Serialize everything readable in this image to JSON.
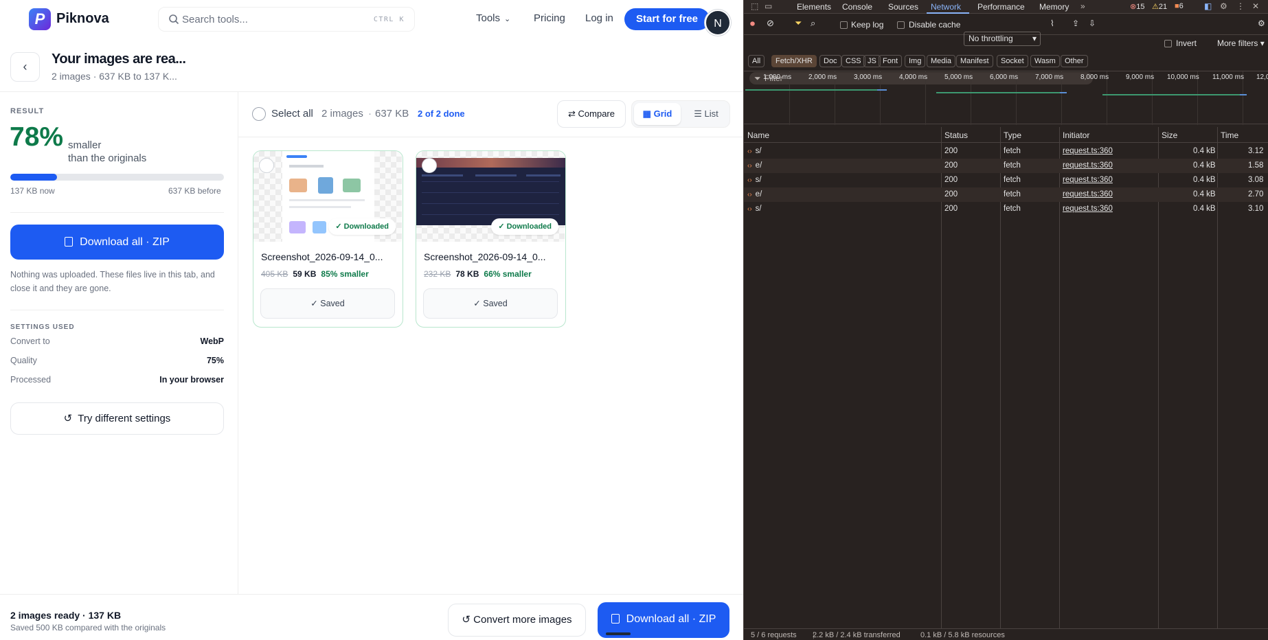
{
  "nav": {
    "logo_letter": "P",
    "logo_name": "Piknova",
    "search_placeholder": "Search tools...",
    "search_shortcut": "CTRL K",
    "tools": "Tools",
    "pricing": "Pricing",
    "login": "Log in",
    "start": "Start for free",
    "avatar_initial": "N"
  },
  "header": {
    "title": "Your images are rea...",
    "subtitle": "2 images · 637 KB to 137 K..."
  },
  "sidebar": {
    "result_label": "RESULT",
    "percent": "78%",
    "smaller": "smaller",
    "than": "than the originals",
    "progress_fraction": 0.22,
    "now": "137 KB now",
    "before": "637 KB before",
    "download_zip": "Download all · ZIP",
    "note": "Nothing was uploaded. These files live in this tab, and close it and they are gone.",
    "settings_label": "SETTINGS USED",
    "settings": [
      {
        "label": "Convert to",
        "value": "WebP"
      },
      {
        "label": "Quality",
        "value": "75%"
      },
      {
        "label": "Processed",
        "value": "In your browser"
      }
    ],
    "try_different": "Try different settings"
  },
  "toolbar": {
    "select_all": "Select all",
    "count": "2 images",
    "dot": "·",
    "size": "637 KB",
    "done": "2 of 2 done",
    "compare": "Compare",
    "grid": "Grid",
    "list": "List"
  },
  "cards": [
    {
      "name": "Screenshot_2026-09-14_0...",
      "old": "405 KB",
      "new": "59 KB",
      "pct": "85% smaller",
      "badge": "Downloaded",
      "saved": "Saved"
    },
    {
      "name": "Screenshot_2026-09-14_0...",
      "old": "232 KB",
      "new": "78 KB",
      "pct": "66% smaller",
      "badge": "Downloaded",
      "saved": "Saved"
    }
  ],
  "bottom": {
    "title": "2 images ready · 137 KB",
    "sub": "Saved 500 KB compared with the originals",
    "convert_more": "Convert more images",
    "download_zip": "Download all · ZIP"
  },
  "devtools": {
    "tabs": [
      "Elements",
      "Console",
      "Sources",
      "Network",
      "Performance",
      "Memory"
    ],
    "active_tab": "Network",
    "errors": "15",
    "warnings": "21",
    "issues": "6",
    "keep_log": "Keep log",
    "disable_cache": "Disable cache",
    "throttling": "No throttling",
    "filter_placeholder": "Filter",
    "invert": "Invert",
    "more_filters": "More filters",
    "chips": [
      "All",
      "Fetch/XHR",
      "Doc",
      "CSS",
      "JS",
      "Font",
      "Img",
      "Media",
      "Manifest",
      "Socket",
      "Wasm",
      "Other"
    ],
    "active_chip": "Fetch/XHR",
    "timeline_labels": [
      "1,000 ms",
      "2,000 ms",
      "3,000 ms",
      "4,000 ms",
      "5,000 ms",
      "6,000 ms",
      "7,000 ms",
      "8,000 ms",
      "9,000 ms",
      "10,000 ms",
      "11,000 ms",
      "12,0"
    ],
    "columns": [
      "Name",
      "Status",
      "Type",
      "Initiator",
      "Size",
      "Time"
    ],
    "rows": [
      {
        "name": "s/",
        "status": "200",
        "type": "fetch",
        "initiator": "request.ts:360",
        "size": "0.4 kB",
        "time": "3.12"
      },
      {
        "name": "e/",
        "status": "200",
        "type": "fetch",
        "initiator": "request.ts:360",
        "size": "0.4 kB",
        "time": "1.58"
      },
      {
        "name": "s/",
        "status": "200",
        "type": "fetch",
        "initiator": "request.ts:360",
        "size": "0.4 kB",
        "time": "3.08"
      },
      {
        "name": "e/",
        "status": "200",
        "type": "fetch",
        "initiator": "request.ts:360",
        "size": "0.4 kB",
        "time": "2.70"
      },
      {
        "name": "s/",
        "status": "200",
        "type": "fetch",
        "initiator": "request.ts:360",
        "size": "0.4 kB",
        "time": "3.10"
      }
    ],
    "status_requests": "5 / 6 requests",
    "status_transferred": "2.2 kB / 2.4 kB transferred",
    "status_resources": "0.1 kB / 5.8 kB resources"
  }
}
